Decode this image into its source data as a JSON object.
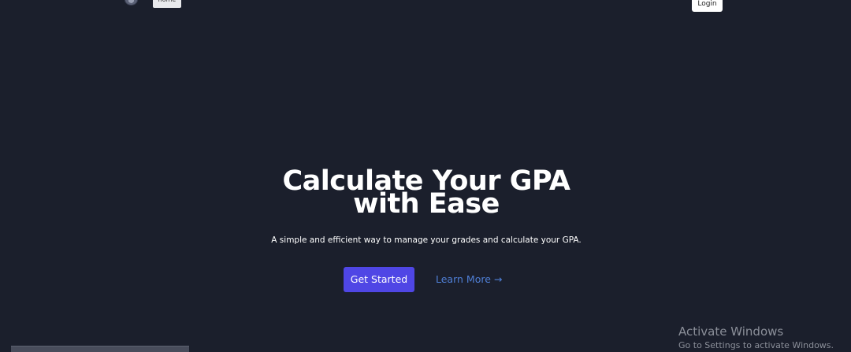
{
  "nav": {
    "home_label": "home",
    "login_label": "Login"
  },
  "hero": {
    "title_line1": "Calculate Your GPA",
    "title_line2": "with Ease",
    "subtitle": "A simple and efficient way to manage your grades and calculate your GPA.",
    "primary_cta": "Get Started",
    "secondary_cta": "Learn More →"
  },
  "watermark": {
    "line1": "Activate Windows",
    "line2": "Go to Settings to activate Windows."
  },
  "colors": {
    "background": "#1b1f2c",
    "primary": "#4f46e5",
    "link": "#4f7fd6"
  }
}
